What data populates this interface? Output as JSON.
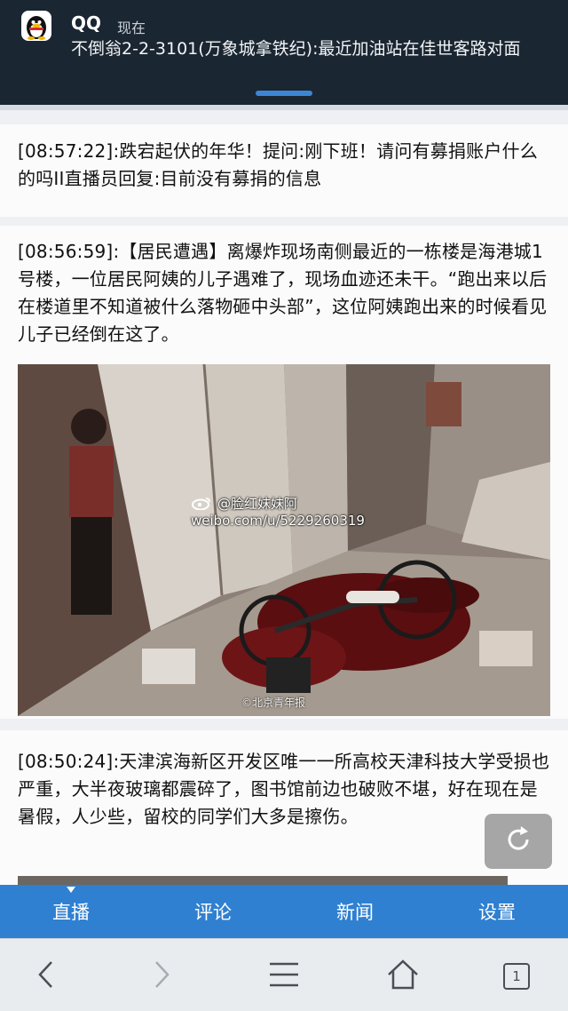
{
  "notification": {
    "app_name": "QQ",
    "time": "现在",
    "message": "不倒翁2-2-3101(万象城拿铁纪):最近加油站在佳世客路对面",
    "app_icon": "penguin-icon"
  },
  "feed": [
    {
      "timestamp": "[08:57:22]",
      "text": ":跌宕起伏的年华！提问:刚下班！请问有募捐账户什么的吗II直播员回复:目前没有募捐的信息"
    },
    {
      "timestamp": "[08:56:59]",
      "text": ":【居民遭遇】离爆炸现场南侧最近的一栋楼是海港城1号楼，一位居民阿姨的儿子遇难了，现场血迹还未干。“跑出来以后在楼道里不知道被什么落物砸中头部”，这位阿姨跑出来的时候看见儿子已经倒在这了。",
      "photo": {
        "watermark_handle": "@脸红妹妹阿",
        "watermark_url": "weibo.com/u/5229260319",
        "credit": "©北京青年报"
      }
    },
    {
      "timestamp": "[08:50:24]",
      "text": ":天津滨海新区开发区唯一一所高校天津科技大学受损也严重，大半夜玻璃都震碎了，图书馆前边也破败不堪，好在现在是暑假，人少些，留校的同学们大多是擦伤。"
    }
  ],
  "tabs": [
    {
      "label": "直播",
      "active": true
    },
    {
      "label": "评论",
      "active": false
    },
    {
      "label": "新闻",
      "active": false
    },
    {
      "label": "设置",
      "active": false
    }
  ],
  "browser_bar": {
    "tab_count": "1",
    "icons": [
      "back-icon",
      "forward-icon",
      "menu-icon",
      "home-icon",
      "tabs-icon"
    ]
  },
  "colors": {
    "tab_bar": "#2f80d1",
    "notification_bg": "#1a2632",
    "notification_handle": "#3d86d6"
  }
}
